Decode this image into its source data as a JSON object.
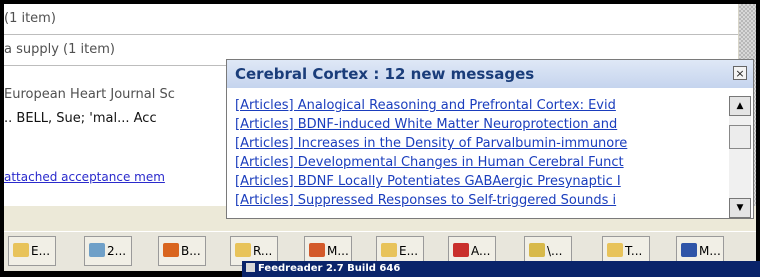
{
  "mail_list": {
    "rows": [
      "(1 item)",
      "a supply (1 item)",
      "European Heart Journal Sc",
      "..  BELL, Sue; 'mal...  Acc",
      "attached acceptance mem"
    ]
  },
  "popup": {
    "title": "Cerebral Cortex : 12 new messages",
    "close_glyph": "×",
    "items": [
      "[Articles] Analogical Reasoning and Prefrontal Cortex: Evid",
      "[Articles] BDNF-induced White Matter Neuroprotection and",
      "[Articles] Increases in the Density of Parvalbumin-immunore",
      "[Articles] Developmental Changes in Human Cerebral Funct",
      "[Articles] BDNF Locally Potentiates GABAergic Presynaptic I",
      "[Articles] Suppressed Responses to Self-triggered Sounds i"
    ],
    "scroll_up_glyph": "▲",
    "scroll_down_glyph": "▼"
  },
  "taskbar": {
    "buttons": [
      {
        "label": "E...",
        "icon": "mail-icon",
        "color": "#e8c35a"
      },
      {
        "label": "2...",
        "icon": "network-icon",
        "color": "#6fa0c8"
      },
      {
        "label": "B...",
        "icon": "firefox-icon",
        "color": "#d9651f"
      },
      {
        "label": "R...",
        "icon": "mail-icon",
        "color": "#e8c35a"
      },
      {
        "label": "M...",
        "icon": "presentation-icon",
        "color": "#d35a2b"
      },
      {
        "label": "E...",
        "icon": "mail-icon",
        "color": "#e8c35a"
      },
      {
        "label": "A...",
        "icon": "pdf-icon",
        "color": "#c9302c"
      },
      {
        "label": "\\...",
        "icon": "folder-search-icon",
        "color": "#d8b94a"
      },
      {
        "label": "T...",
        "icon": "mail-icon",
        "color": "#e8c35a"
      },
      {
        "label": "M...",
        "icon": "word-icon",
        "color": "#2f55a8"
      }
    ]
  },
  "tooltip": {
    "text": "Feedreader 2.7 Build 646"
  }
}
